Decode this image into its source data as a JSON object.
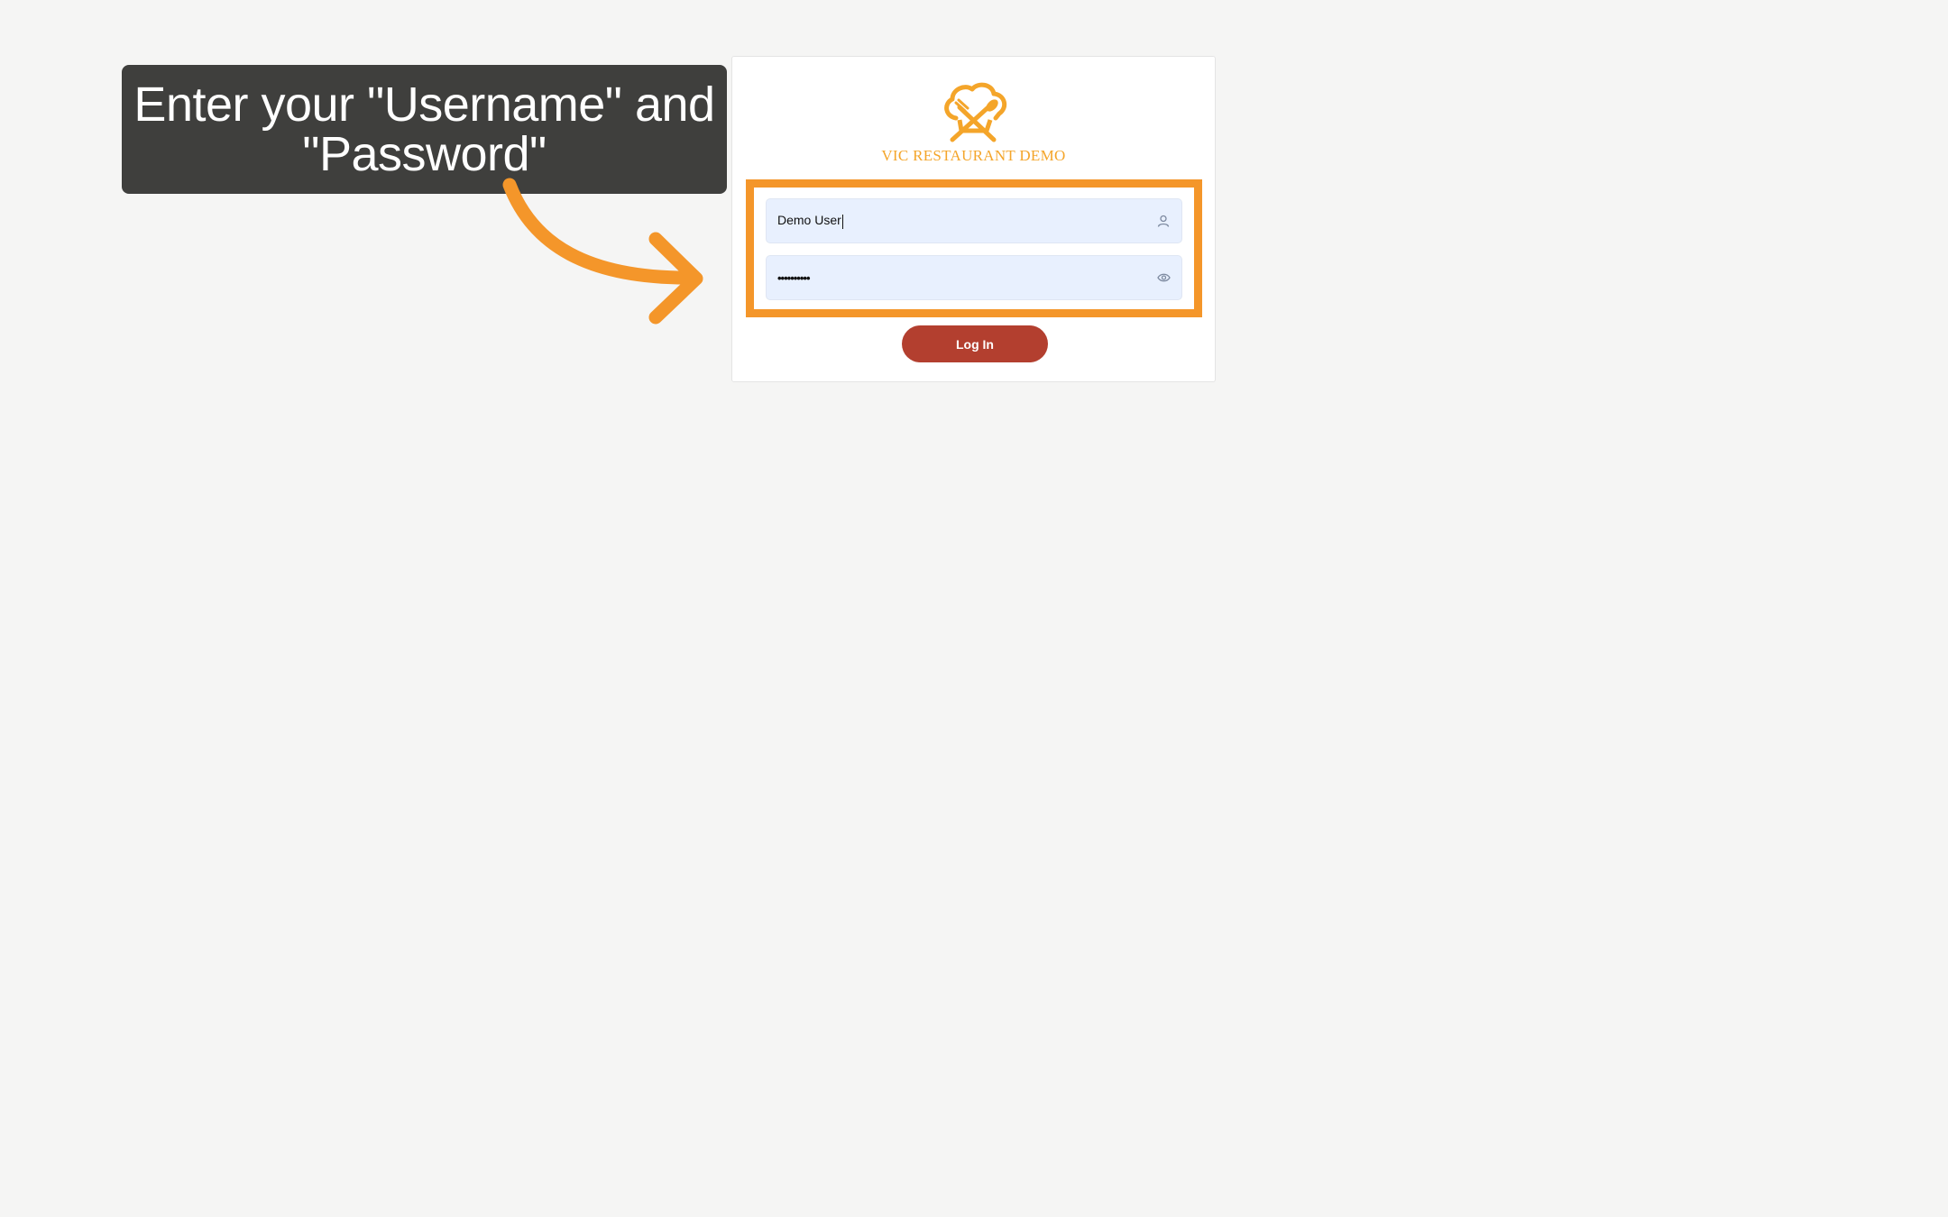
{
  "callout": {
    "text": "Enter your \"Username\" and \"Password\""
  },
  "login_card": {
    "brand_name": "VIC RESTAURANT DEMO",
    "logo_icon": "chef-hat-cutlery-logo",
    "username": {
      "value": "Demo User",
      "icon": "user-icon"
    },
    "password": {
      "value": "••••••••••",
      "icon": "eye-icon"
    },
    "login_button_label": "Log In"
  },
  "colors": {
    "background": "#f5f5f4",
    "accent_orange": "#f4962a",
    "brand_gold": "#f4a52a",
    "button_red": "#b33f2f",
    "field_fill": "#e8f0fe",
    "callout_bg": "#3f3f3d"
  }
}
